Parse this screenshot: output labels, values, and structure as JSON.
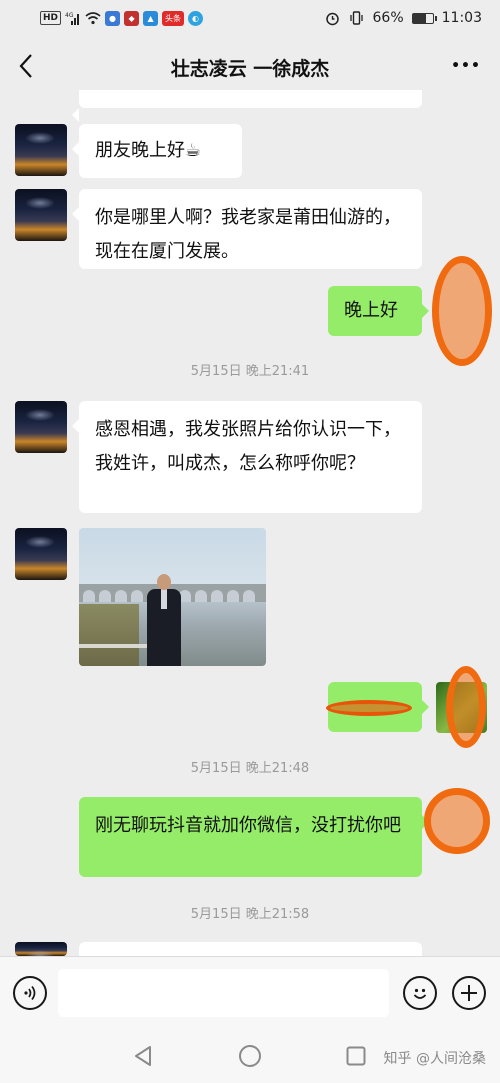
{
  "status_bar": {
    "network_label": "HD",
    "signal_label": "4G",
    "app_badge": "头条",
    "battery_percent": "66%",
    "battery_level": 0.66,
    "time": "11:03"
  },
  "header": {
    "title": "壮志凌云 一徐成杰",
    "more_label": "•••"
  },
  "messages": [
    {
      "side": "left",
      "text": "朋友晚上好☕"
    },
    {
      "side": "left",
      "text": "你是哪里人啊？我老家是莆田仙游的，现在在厦门发展。"
    },
    {
      "side": "right",
      "text": "晚上好"
    },
    {
      "side": "left",
      "text": "感恩相遇，我发张照片给你认识一下，我姓许，叫成杰，怎么称呼你呢？"
    },
    {
      "side": "right",
      "text": "刚无聊玩抖音就加你微信，没打扰你吧"
    }
  ],
  "timestamps": [
    "5月15日 晚上21:41",
    "5月15日 晚上21:48",
    "5月15日 晚上21:58"
  ],
  "input_bar": {
    "voice_icon": "voice-icon",
    "emoji_icon": "emoji-icon",
    "plus_icon": "plus-icon",
    "input_value": ""
  },
  "watermark": "知乎 @人间沧桑",
  "colors": {
    "background": "#ededed",
    "bubble_left": "#ffffff",
    "bubble_right": "#95ec69",
    "scribble": "#f06a10"
  }
}
